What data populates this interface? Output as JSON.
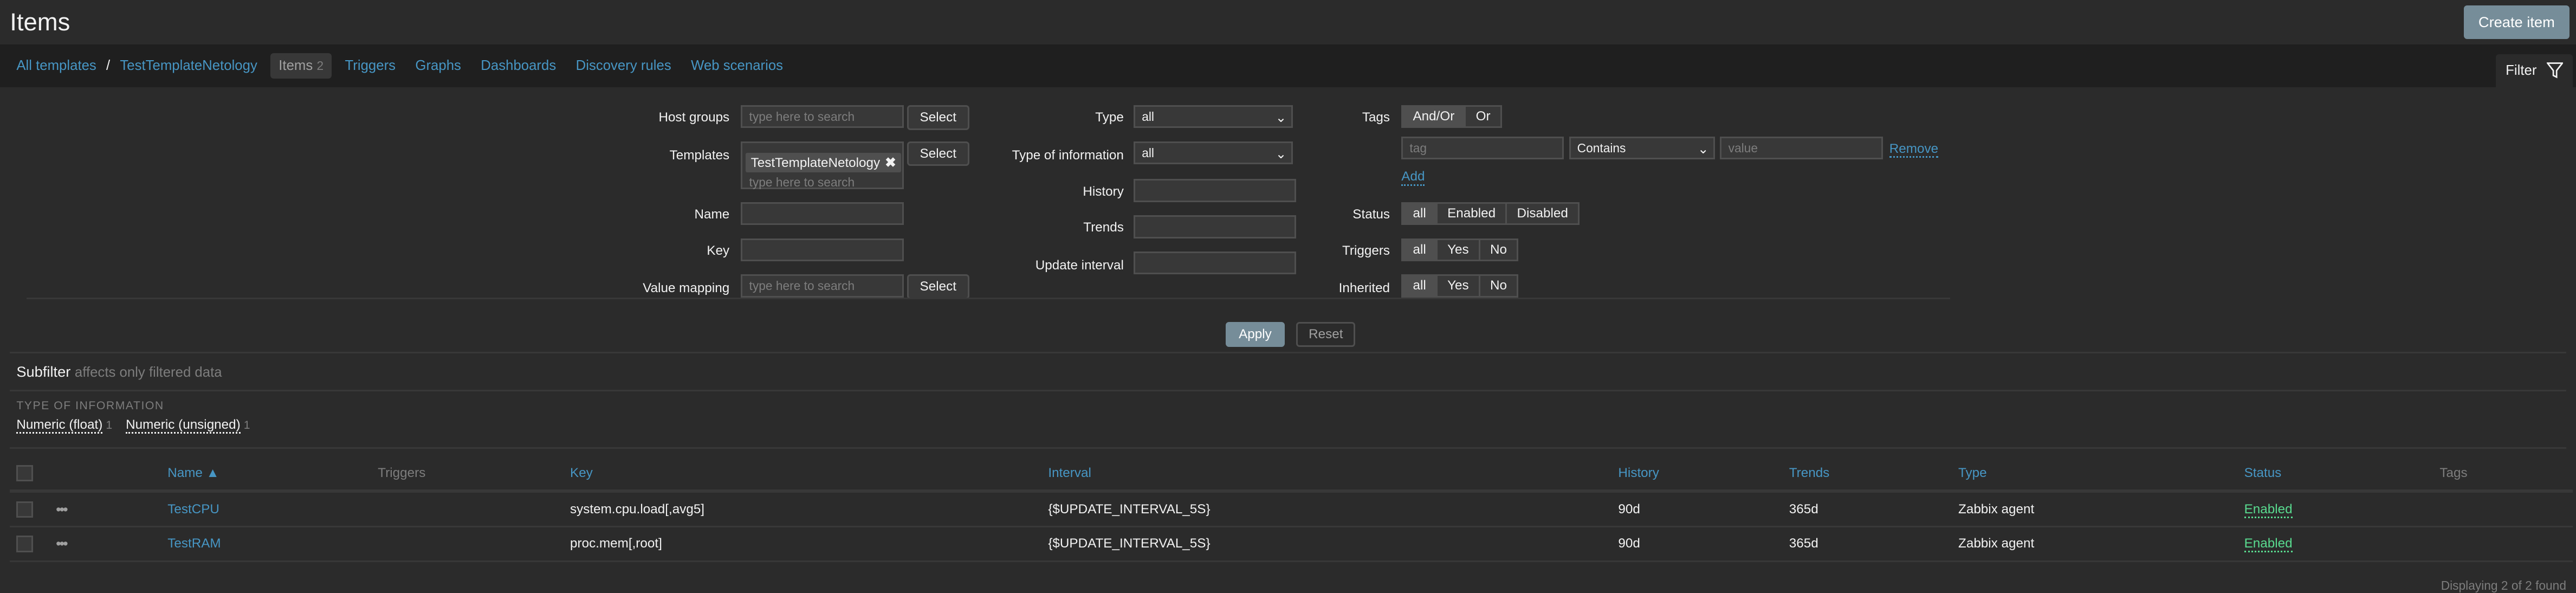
{
  "header": {
    "title": "Items",
    "create_label": "Create item"
  },
  "nav": {
    "breadcrumb": [
      "All templates",
      "TestTemplateNetology"
    ],
    "separator": "/",
    "tabs": [
      {
        "label": "Items",
        "count": "2"
      },
      {
        "label": "Triggers"
      },
      {
        "label": "Graphs"
      },
      {
        "label": "Dashboards"
      },
      {
        "label": "Discovery rules"
      },
      {
        "label": "Web scenarios"
      }
    ],
    "filter_label": "Filter"
  },
  "filter": {
    "host_groups": {
      "label": "Host groups",
      "placeholder": "type here to search",
      "button": "Select"
    },
    "templates": {
      "label": "Templates",
      "chip": "TestTemplateNetology",
      "placeholder": "type here to search",
      "button": "Select"
    },
    "name": {
      "label": "Name"
    },
    "key": {
      "label": "Key"
    },
    "value_mapping": {
      "label": "Value mapping",
      "placeholder": "type here to search",
      "button": "Select"
    },
    "type": {
      "label": "Type",
      "value": "all"
    },
    "type_of_information": {
      "label": "Type of information",
      "value": "all"
    },
    "history": {
      "label": "History"
    },
    "trends": {
      "label": "Trends"
    },
    "update_interval": {
      "label": "Update interval"
    },
    "tags": {
      "label": "Tags",
      "mode_options": [
        "And/Or",
        "Or"
      ],
      "tag_placeholder": "tag",
      "operator": "Contains",
      "value_placeholder": "value",
      "remove": "Remove",
      "add": "Add"
    },
    "status": {
      "label": "Status",
      "options": [
        "all",
        "Enabled",
        "Disabled"
      ]
    },
    "triggers": {
      "label": "Triggers",
      "options": [
        "all",
        "Yes",
        "No"
      ]
    },
    "inherited": {
      "label": "Inherited",
      "options": [
        "all",
        "Yes",
        "No"
      ]
    },
    "apply": "Apply",
    "reset": "Reset"
  },
  "subfilter": {
    "title": "Subfilter",
    "note": "affects only filtered data",
    "group": "TYPE OF INFORMATION",
    "values": [
      {
        "label": "Numeric (float)",
        "count": "1"
      },
      {
        "label": "Numeric (unsigned)",
        "count": "1"
      }
    ]
  },
  "table": {
    "headers": {
      "name": "Name ▲",
      "triggers": "Triggers",
      "key": "Key",
      "interval": "Interval",
      "history": "History",
      "trends": "Trends",
      "type": "Type",
      "status": "Status",
      "tags": "Tags"
    },
    "rows": [
      {
        "name": "TestCPU",
        "key": "system.cpu.load[,avg5]",
        "interval": "{$UPDATE_INTERVAL_5S}",
        "history": "90d",
        "trends": "365d",
        "type": "Zabbix agent",
        "status": "Enabled"
      },
      {
        "name": "TestRAM",
        "key": "proc.mem[,root]",
        "interval": "{$UPDATE_INTERVAL_5S}",
        "history": "90d",
        "trends": "365d",
        "type": "Zabbix agent",
        "status": "Enabled"
      }
    ],
    "footer": "Displaying 2 of 2 found"
  }
}
